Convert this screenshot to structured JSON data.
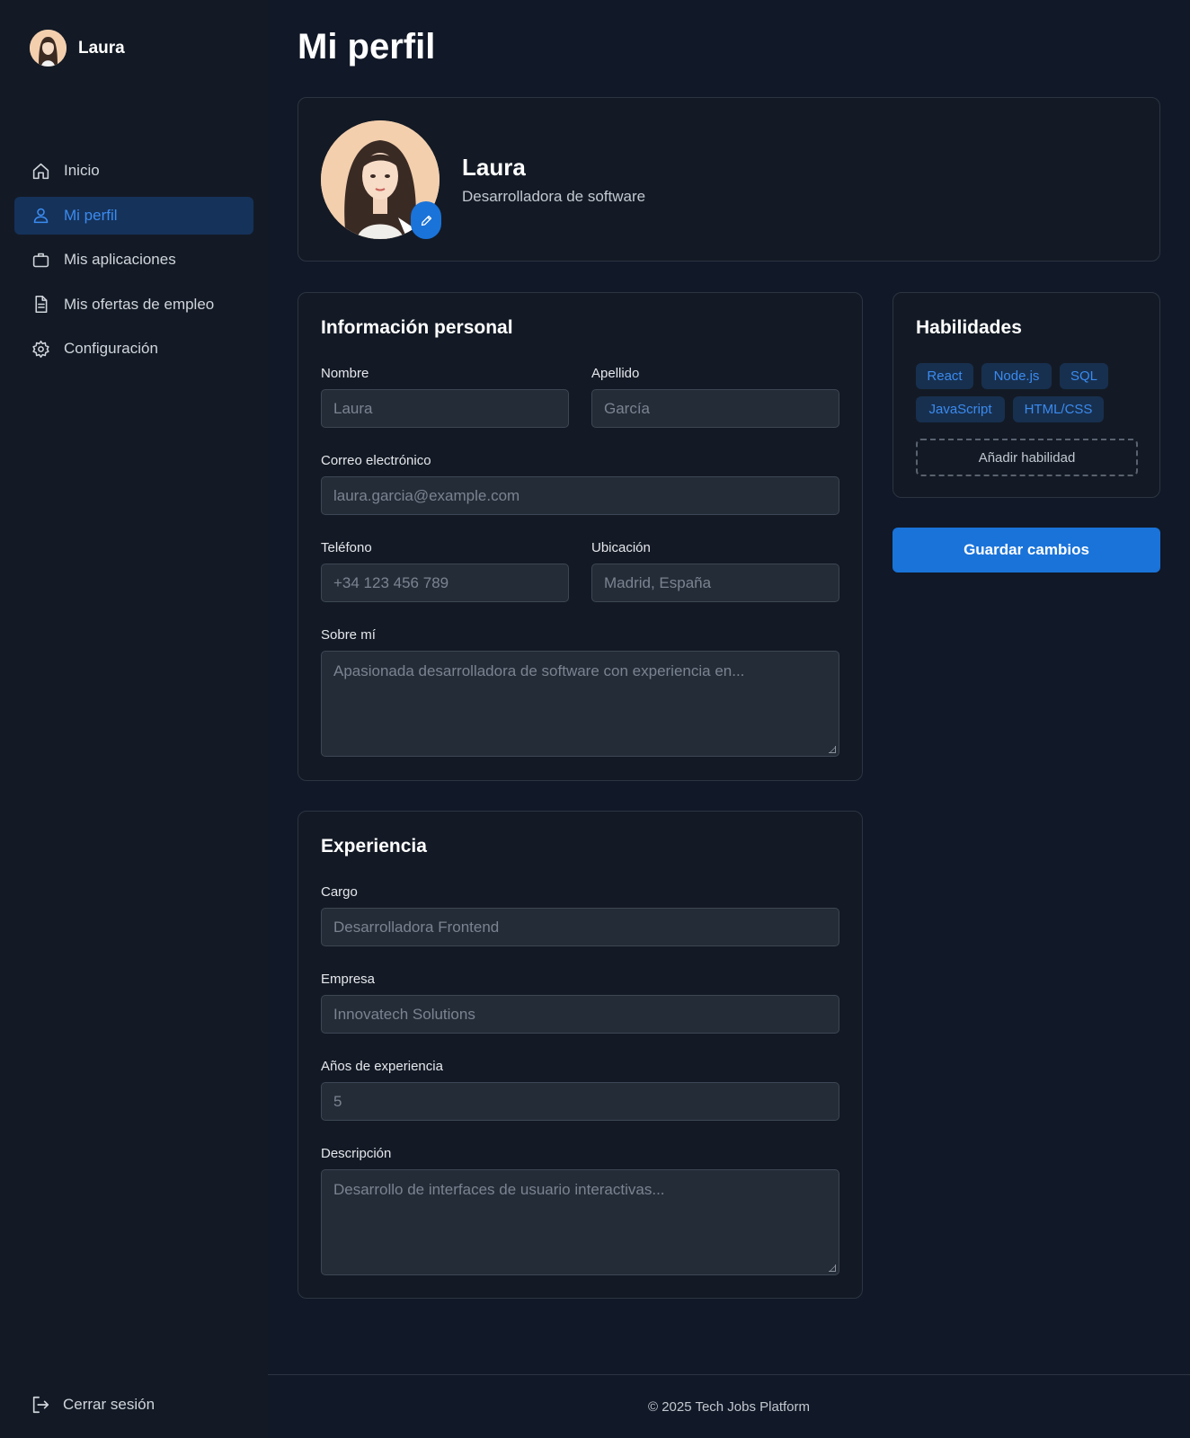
{
  "sidebar": {
    "user_name": "Laura",
    "items": [
      {
        "label": "Inicio",
        "icon": "home-icon"
      },
      {
        "label": "Mi perfil",
        "icon": "user-icon"
      },
      {
        "label": "Mis aplicaciones",
        "icon": "briefcase-icon"
      },
      {
        "label": "Mis ofertas de empleo",
        "icon": "document-icon"
      },
      {
        "label": "Configuración",
        "icon": "gear-icon"
      }
    ],
    "logout_label": "Cerrar sesión"
  },
  "page": {
    "title": "Mi perfil"
  },
  "profile": {
    "name": "Laura",
    "role": "Desarrolladora de software"
  },
  "personal": {
    "title": "Información personal",
    "first_name_label": "Nombre",
    "first_name_placeholder": "Laura",
    "last_name_label": "Apellido",
    "last_name_placeholder": "García",
    "email_label": "Correo electrónico",
    "email_placeholder": "laura.garcia@example.com",
    "phone_label": "Teléfono",
    "phone_placeholder": "+34 123 456 789",
    "location_label": "Ubicación",
    "location_placeholder": "Madrid, España",
    "about_label": "Sobre mí",
    "about_placeholder": "Apasionada desarrolladora de software con experiencia en..."
  },
  "experience": {
    "title": "Experiencia",
    "position_label": "Cargo",
    "position_placeholder": "Desarrolladora Frontend",
    "company_label": "Empresa",
    "company_placeholder": "Innovatech Solutions",
    "years_label": "Años de experiencia",
    "years_placeholder": "5",
    "description_label": "Descripción",
    "description_placeholder": "Desarrollo de interfaces de usuario interactivas..."
  },
  "skills": {
    "title": "Habilidades",
    "tags": [
      "React",
      "Node.js",
      "SQL",
      "JavaScript",
      "HTML/CSS"
    ],
    "add_label": "Añadir habilidad"
  },
  "actions": {
    "save_label": "Guardar cambios"
  },
  "footer": {
    "text": "© 2025 Tech Jobs Platform"
  },
  "colors": {
    "background": "#111827",
    "sidebar": "#131a25",
    "accent": "#1a73d9",
    "active_nav_bg": "#15325a",
    "tag_bg": "#18304f",
    "tag_text": "#3a8bf0"
  }
}
